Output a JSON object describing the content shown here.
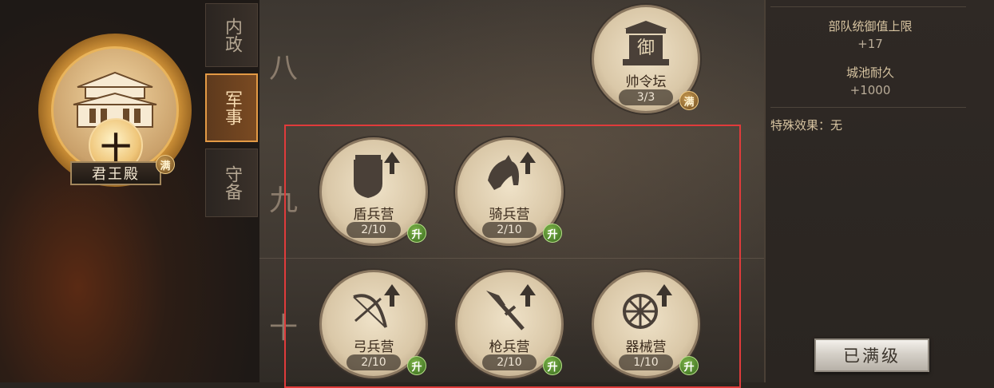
{
  "left": {
    "main_building": {
      "name": "君王殿",
      "level": "十",
      "badge": "满"
    },
    "tabs": [
      {
        "label": "内政",
        "active": false
      },
      {
        "label": "军事",
        "active": true
      },
      {
        "label": "守备",
        "active": false
      }
    ]
  },
  "rows": [
    {
      "numeral": "八"
    },
    {
      "numeral": "九"
    },
    {
      "numeral": "十"
    }
  ],
  "buildings": {
    "command_altar": {
      "name": "帅令坛",
      "count": "3/3",
      "badge": "满",
      "icon": "altar-icon"
    },
    "shield_camp": {
      "name": "盾兵营",
      "count": "2/10",
      "badge": "升",
      "icon": "shield-icon"
    },
    "cavalry_camp": {
      "name": "骑兵营",
      "count": "2/10",
      "badge": "升",
      "icon": "horse-icon"
    },
    "archer_camp": {
      "name": "弓兵营",
      "count": "2/10",
      "badge": "升",
      "icon": "bow-icon"
    },
    "spear_camp": {
      "name": "枪兵营",
      "count": "2/10",
      "badge": "升",
      "icon": "spear-icon"
    },
    "siege_camp": {
      "name": "器械营",
      "count": "1/10",
      "badge": "升",
      "icon": "wheel-icon"
    }
  },
  "panel": {
    "stats": [
      {
        "title": "部队统御值上限",
        "value": "+17"
      },
      {
        "title": "城池耐久",
        "value": "+1000"
      }
    ],
    "special_effect": "特殊效果：无",
    "max_level_button": "已满级"
  },
  "colors": {
    "selection_frame": "#e03b3b",
    "upgrade_badge": "#4f8a2a",
    "full_badge": "#8a5f28",
    "active_tab_border": "#e39a45"
  }
}
